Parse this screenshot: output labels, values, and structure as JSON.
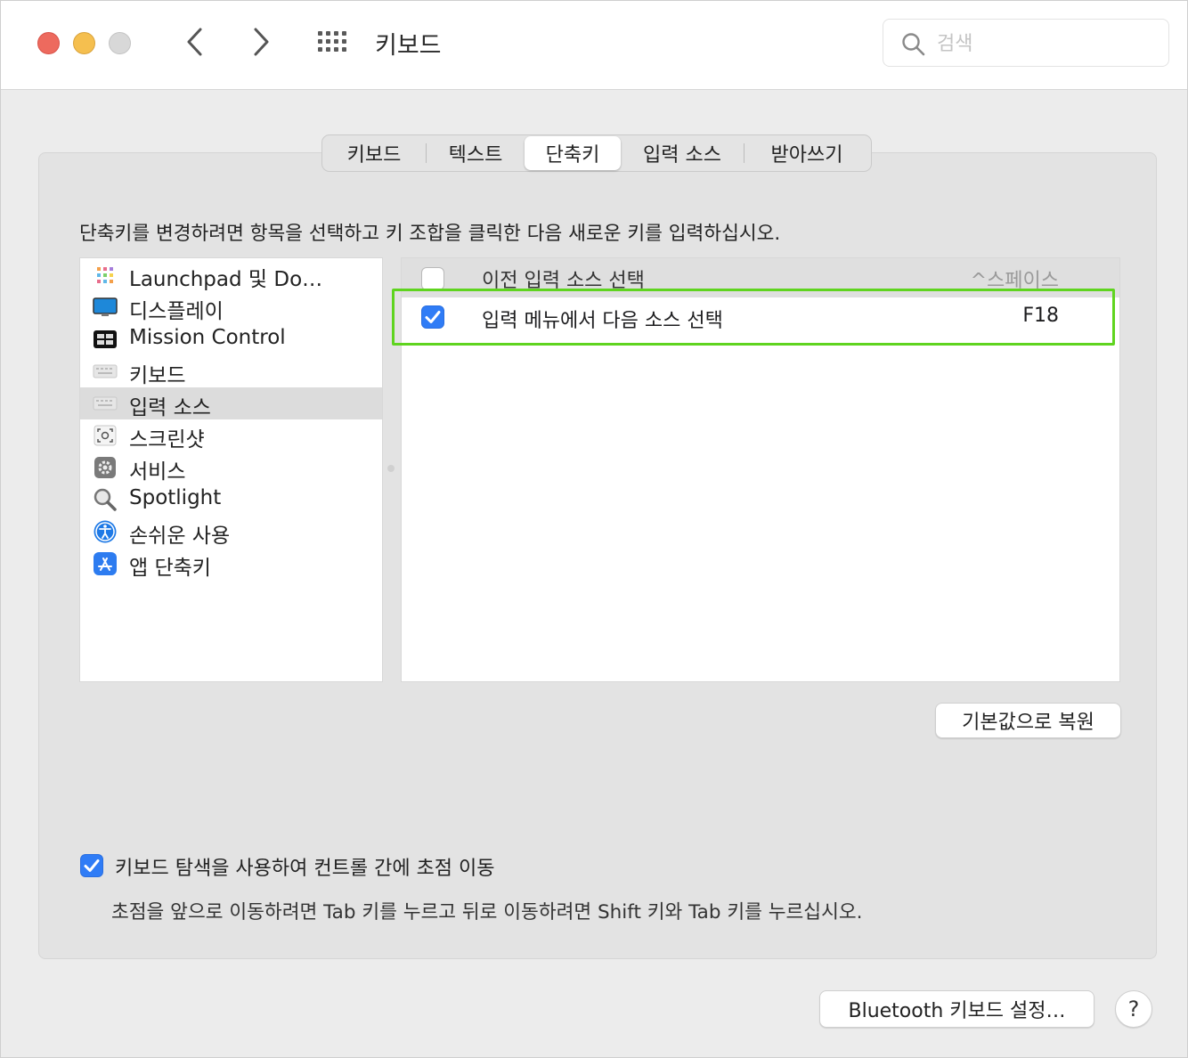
{
  "window": {
    "title": "키보드"
  },
  "search": {
    "placeholder": "검색",
    "value": ""
  },
  "tabs": [
    {
      "label": "키보드",
      "selected": false
    },
    {
      "label": "텍스트",
      "selected": false
    },
    {
      "label": "단축키",
      "selected": true
    },
    {
      "label": "입력 소스",
      "selected": false
    },
    {
      "label": "받아쓰기",
      "selected": false
    }
  ],
  "instruction": "단축키를 변경하려면 항목을 선택하고 키 조합을 클릭한 다음 새로운 키를 입력하십시오.",
  "categories": [
    {
      "label": "Launchpad 및 Do…",
      "icon": "launchpad-icon",
      "selected": false
    },
    {
      "label": "디스플레이",
      "icon": "display-icon",
      "selected": false
    },
    {
      "label": "Mission Control",
      "icon": "mission-control-icon",
      "selected": false
    },
    {
      "label": "키보드",
      "icon": "keyboard-icon",
      "selected": false
    },
    {
      "label": "입력 소스",
      "icon": "input-source-icon",
      "selected": true
    },
    {
      "label": "스크린샷",
      "icon": "screenshot-icon",
      "selected": false
    },
    {
      "label": "서비스",
      "icon": "gear-icon",
      "selected": false
    },
    {
      "label": "Spotlight",
      "icon": "magnifier-icon",
      "selected": false
    },
    {
      "label": "손쉬운 사용",
      "icon": "accessibility-icon",
      "selected": false
    },
    {
      "label": "앱 단축키",
      "icon": "app-store-icon",
      "selected": false
    }
  ],
  "shortcuts": [
    {
      "checked": false,
      "description": "이전 입력 소스 선택",
      "key": "^스페이스"
    },
    {
      "checked": true,
      "description": "입력 메뉴에서 다음 소스 선택",
      "key": "F18"
    }
  ],
  "buttons": {
    "restore_defaults": "기본값으로 복원",
    "bluetooth_keyboard": "Bluetooth 키보드 설정…",
    "help": "?"
  },
  "keyboard_navigation": {
    "checked": true,
    "label": "키보드 탐색을 사용하여 컨트롤 간에 초점 이동",
    "hint": "초점을 앞으로 이동하려면 Tab 키를 누르고 뒤로 이동하려면 Shift 키와 Tab 키를 누르십시오."
  },
  "colors": {
    "accent": "#2f7cf6",
    "highlight_box": "#5fd41f",
    "close": "#ed6a5e",
    "minimize": "#f5bf4f",
    "zoom_disabled": "#d8d8d8"
  }
}
